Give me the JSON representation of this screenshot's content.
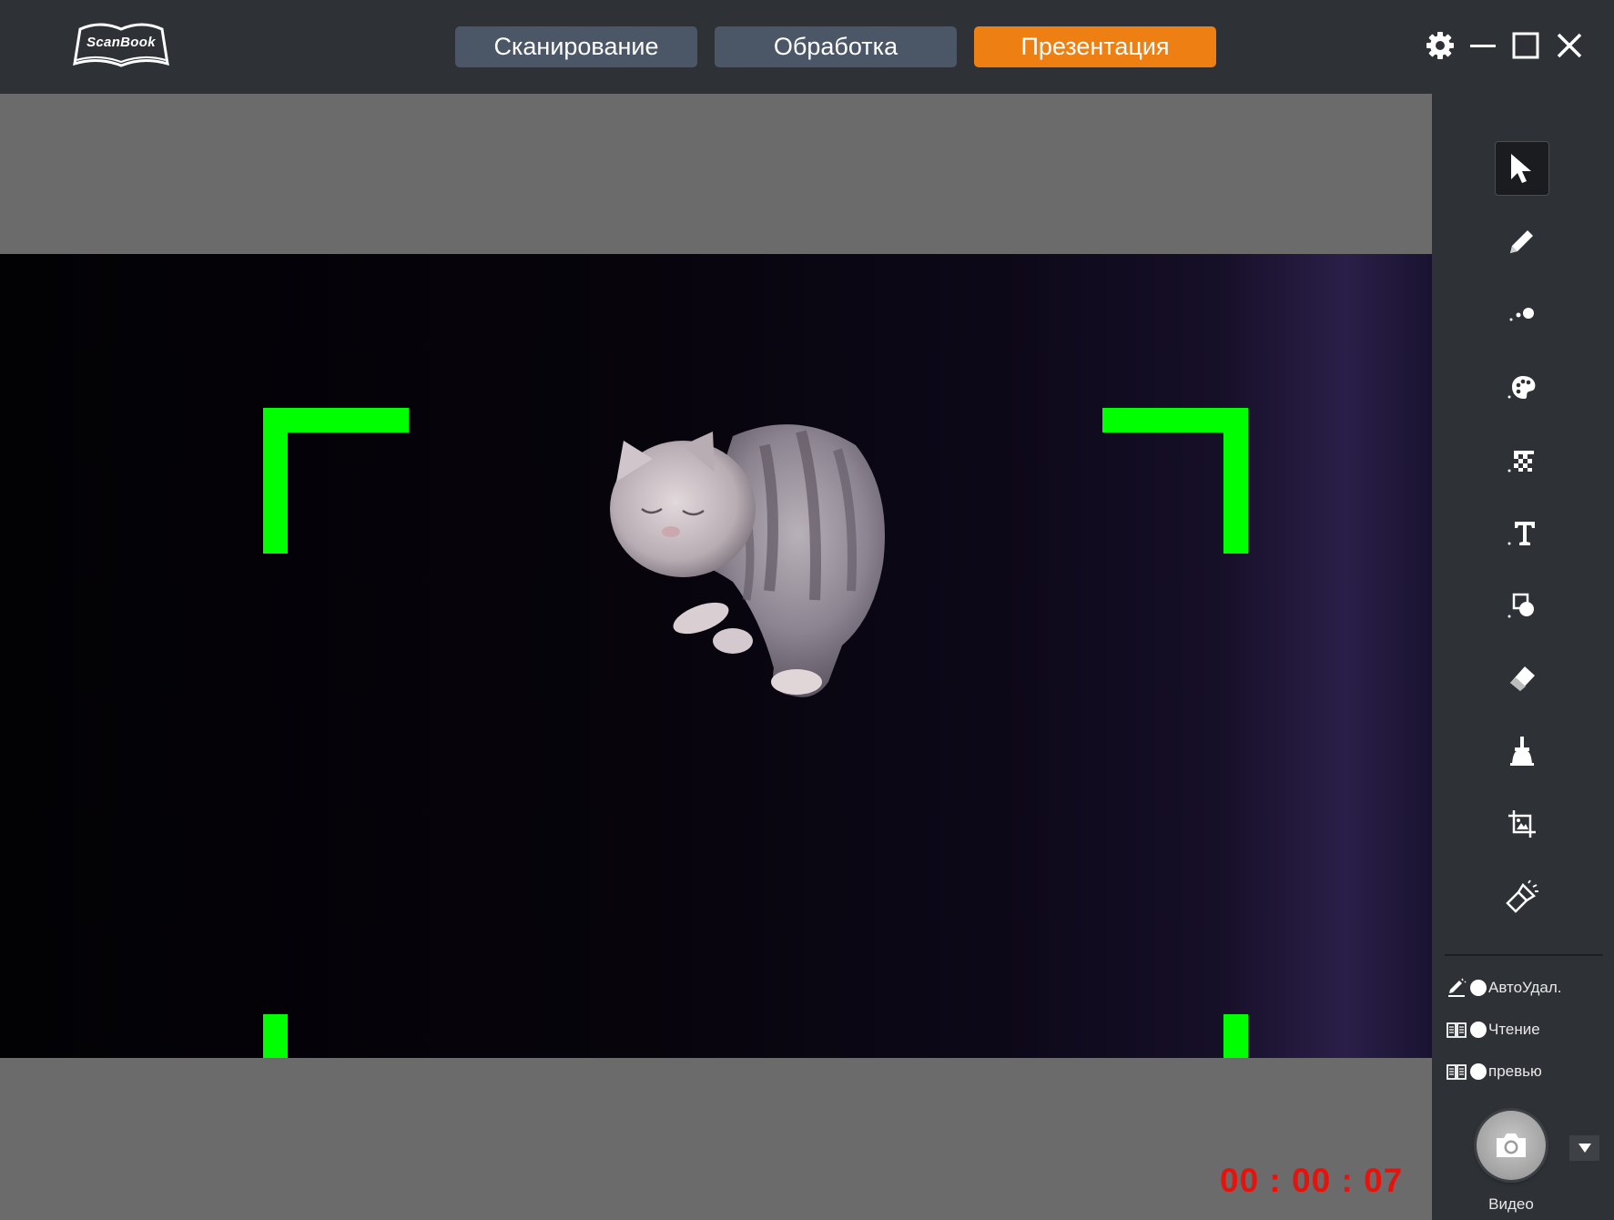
{
  "app": {
    "logo_text": "ScanBook"
  },
  "tabs": [
    {
      "label": "Сканирование",
      "active": false
    },
    {
      "label": "Обработка",
      "active": false
    },
    {
      "label": "Презентация",
      "active": true
    }
  ],
  "window_controls": [
    "gear-icon",
    "minimize-icon",
    "maximize-icon",
    "close-icon"
  ],
  "preview": {
    "timer": "00 : 00 : 07",
    "frame_color": "#00ff00"
  },
  "tools": [
    {
      "name": "pointer-tool",
      "icon": "cursor-arrow-icon",
      "selected": true
    },
    {
      "name": "pen-tool",
      "icon": "pencil-icon",
      "selected": false
    },
    {
      "name": "line-width-tool",
      "icon": "dot-size-icon",
      "selected": false
    },
    {
      "name": "color-tool",
      "icon": "palette-icon",
      "selected": false
    },
    {
      "name": "mosaic-tool",
      "icon": "mosaic-icon",
      "selected": false
    },
    {
      "name": "text-tool",
      "icon": "text-t-icon",
      "selected": false
    },
    {
      "name": "shape-tool",
      "icon": "shapes-icon",
      "selected": false
    },
    {
      "name": "eraser-tool",
      "icon": "eraser-icon",
      "selected": false
    },
    {
      "name": "clear-tool",
      "icon": "broom-icon",
      "selected": false
    },
    {
      "name": "crop-tool",
      "icon": "crop-image-icon",
      "selected": false
    },
    {
      "name": "spotlight-tool",
      "icon": "flashlight-icon",
      "selected": false
    }
  ],
  "options": {
    "auto_delete": "АвтоУдал.",
    "reading": "Чтение",
    "preview": "превью"
  },
  "capture": {
    "label": "Видео"
  },
  "colors": {
    "topbar": "#2e3136",
    "tab_inactive": "#4b5666",
    "tab_active": "#ee7f12",
    "timer": "#e8120c"
  }
}
